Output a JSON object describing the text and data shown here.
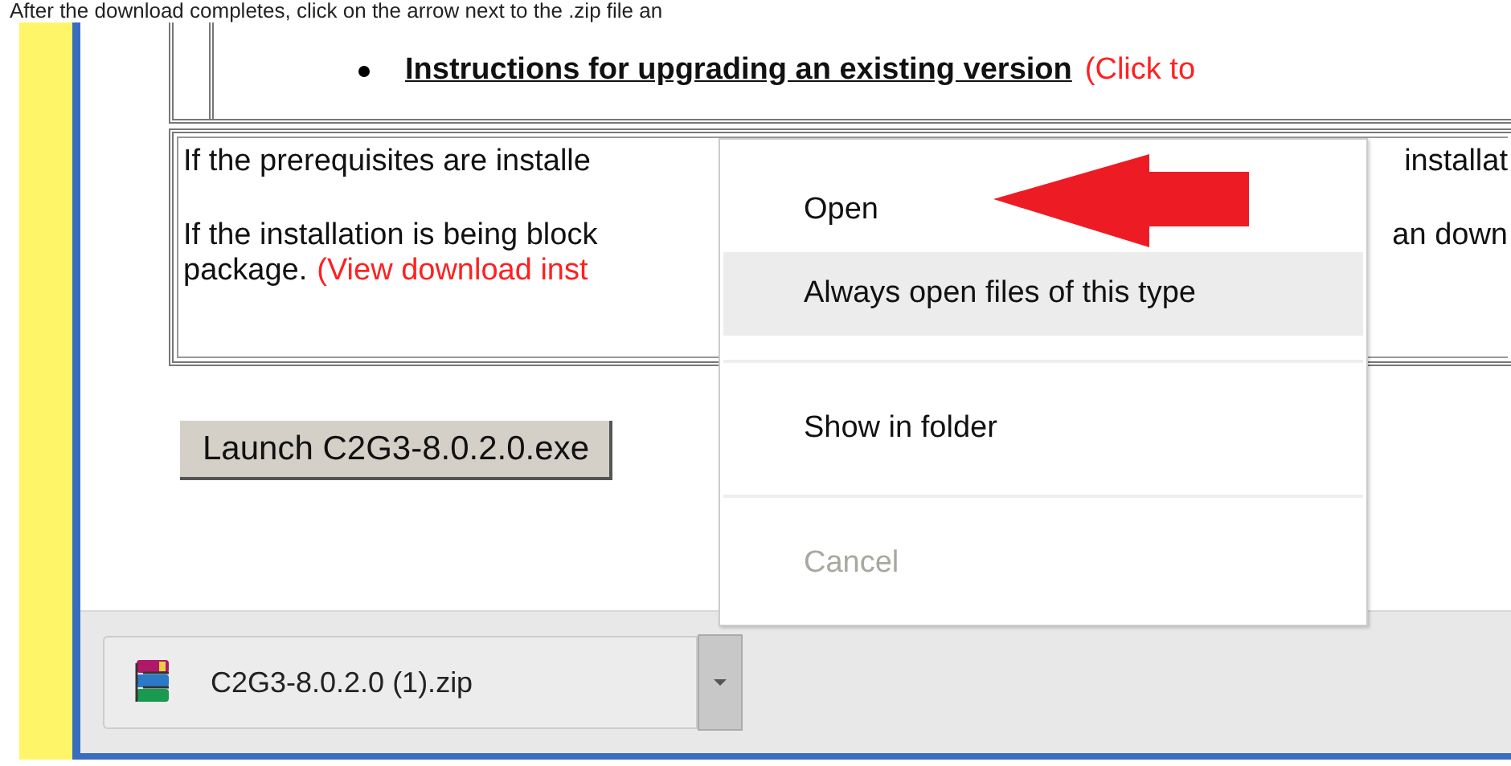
{
  "caption": "After the download completes, click on the arrow next to the .zip file an",
  "upgrade_item": {
    "link": "Instructions for upgrading an existing version",
    "note": "(Click to"
  },
  "notes": [
    {
      "left": "If the prerequisites are installe",
      "right": "installat"
    },
    {
      "left": "If the installation is being block",
      "right": "an down",
      "continuation": "package.",
      "link": "(View download inst"
    }
  ],
  "launch_button": "Launch C2G3-8.0.2.0.exe",
  "download_bar": {
    "file_name": "C2G3-8.0.2.0 (1).zip"
  },
  "context_menu": [
    [
      {
        "label": "Open",
        "selected": false,
        "disabled": false
      },
      {
        "label": "Always open files of this type",
        "selected": true,
        "disabled": false
      }
    ],
    [
      {
        "label": "Show in folder",
        "selected": false,
        "disabled": false
      }
    ],
    [
      {
        "label": "Cancel",
        "selected": false,
        "disabled": true
      }
    ]
  ]
}
